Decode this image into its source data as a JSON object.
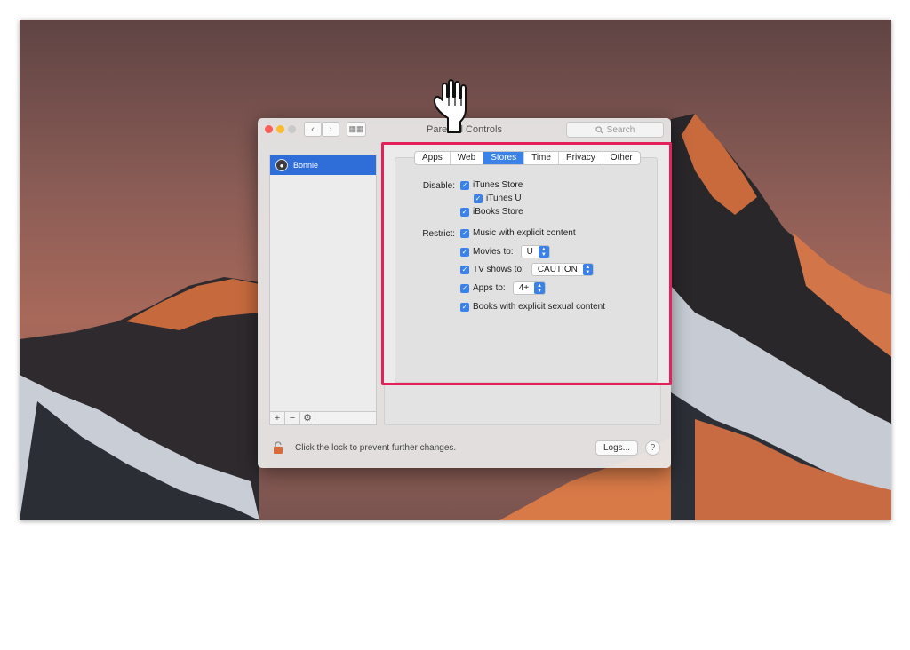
{
  "window": {
    "title": "Parental Controls",
    "search_placeholder": "Search",
    "back_glyph": "‹",
    "forward_glyph": "›",
    "grid_glyph": "▦▦"
  },
  "sidebar": {
    "users": [
      {
        "name": "Bonnie",
        "selected": true
      }
    ],
    "tools": {
      "add": "+",
      "remove": "−",
      "gear": "⚙"
    }
  },
  "tabs": [
    {
      "label": "Apps",
      "active": false
    },
    {
      "label": "Web",
      "active": false
    },
    {
      "label": "Stores",
      "active": true
    },
    {
      "label": "Time",
      "active": false
    },
    {
      "label": "Privacy",
      "active": false
    },
    {
      "label": "Other",
      "active": false
    }
  ],
  "stores": {
    "disable_label": "Disable:",
    "restrict_label": "Restrict:",
    "disable": {
      "itunes_store": {
        "label": "iTunes Store",
        "checked": true
      },
      "itunes_u": {
        "label": "iTunes U",
        "checked": true
      },
      "ibooks_store": {
        "label": "iBooks Store",
        "checked": true
      }
    },
    "restrict": {
      "music": {
        "label": "Music with explicit content",
        "checked": true
      },
      "movies": {
        "label": "Movies to:",
        "checked": true,
        "value": "U"
      },
      "tv_shows": {
        "label": "TV shows to:",
        "checked": true,
        "value": "CAUTION"
      },
      "apps": {
        "label": "Apps to:",
        "checked": true,
        "value": "4+"
      },
      "books": {
        "label": "Books with explicit sexual content",
        "checked": true
      }
    }
  },
  "footer": {
    "lock_text": "Click the lock to prevent further changes.",
    "logs_label": "Logs...",
    "help_label": "?"
  },
  "colors": {
    "accent": "#3b82e8",
    "highlight_border": "#e5215c",
    "selected_row": "#2f6ed8"
  },
  "icons": {
    "cursor": "pointing-hand-icon",
    "lock": "lock-icon",
    "check": "✓"
  }
}
